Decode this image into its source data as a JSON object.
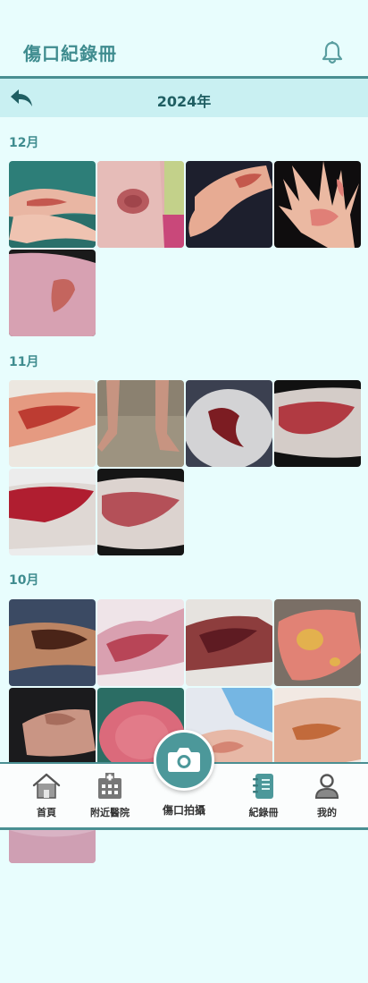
{
  "app": {
    "title": "傷口紀錄冊"
  },
  "icons": {
    "notification": "bell-icon",
    "back": "back-arrow-icon",
    "camera": "camera-icon"
  },
  "year_bar": {
    "title": "2024年"
  },
  "sections": [
    {
      "month": "12月",
      "photo_count": 5
    },
    {
      "month": "11月",
      "photo_count": 6
    },
    {
      "month": "10月",
      "photo_count": 9
    }
  ],
  "bottom_nav": {
    "home": "首頁",
    "nearby_hospitals": "附近醫院",
    "capture": "傷口拍攝",
    "records": "紀錄冊",
    "profile": "我的"
  },
  "colors": {
    "background": "#e8fdfd",
    "accent": "#4c989a",
    "year_bar": "#c9f0f2",
    "title_text": "#3f8c8f"
  }
}
